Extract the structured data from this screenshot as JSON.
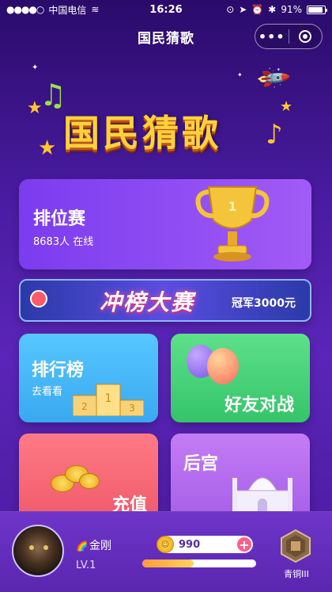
{
  "status_bar": {
    "carrier": "中国电信",
    "time": "16:26",
    "battery": "91%"
  },
  "nav": {
    "title": "国民猜歌",
    "more_icon": "more-dots-icon",
    "close_icon": "target-icon"
  },
  "logo": {
    "text": "国民猜歌"
  },
  "rank_match": {
    "title": "排位赛",
    "online": "8683人 在线"
  },
  "banner": {
    "title": "冲榜大赛",
    "prize": "冠军3000元"
  },
  "cards": {
    "leaderboard": {
      "title": "排行榜",
      "sub": "去看看"
    },
    "friend_battle": {
      "title": "好友对战"
    },
    "recharge": {
      "title": "充值"
    },
    "palace": {
      "title": "后宫"
    }
  },
  "user": {
    "name": "金刚",
    "level": "LV.1",
    "coins": "990",
    "rank": "青铜III",
    "xp_fraction": 0.45
  },
  "colors": {
    "accent": "#7b3cf0",
    "coin": "#f2b01e",
    "plus": "#ff5f8a"
  }
}
